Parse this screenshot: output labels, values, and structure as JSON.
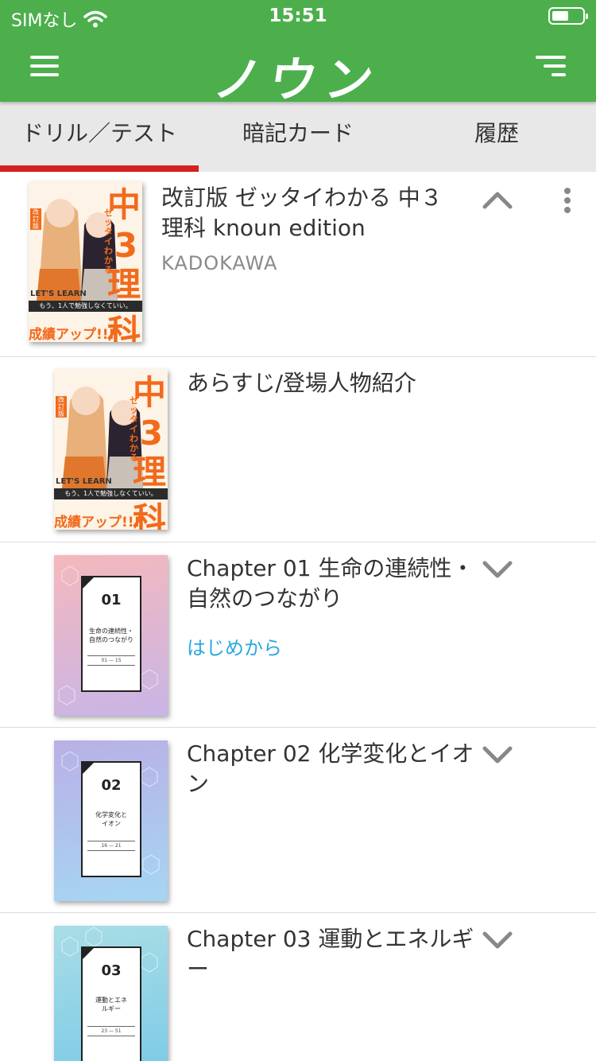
{
  "status_bar": {
    "carrier": "SIMなし",
    "time": "15:51"
  },
  "header": {
    "app_title": "ノウン"
  },
  "tabs": [
    {
      "label": "ドリル／テスト",
      "active": true
    },
    {
      "label": "暗記カード",
      "active": false
    },
    {
      "label": "履歴",
      "active": false
    }
  ],
  "book": {
    "title": "改訂版 ゼッタイわかる 中３理科 knoun edition",
    "publisher": "KADOKAWA",
    "cover": {
      "big_chars": [
        "中",
        "3",
        "理",
        "科"
      ],
      "vertical_title": "ゼッタイわかる",
      "badge": "改訂版",
      "banner": "もう、1人で勉強しなくていい。",
      "english": "LET'S LEARN",
      "footer": "成績アップ!!!"
    }
  },
  "items": [
    {
      "title": "あらすじ/登場人物紹介",
      "action": "はじめから"
    },
    {
      "title": "Chapter 01 生命の連続性・自然のつながり",
      "cover_number": "01",
      "cover_text": "生命の連続性・自然のつながり",
      "cover_pages": "01 — 15"
    },
    {
      "title": "Chapter 02 化学変化とイオン",
      "cover_number": "02",
      "cover_text": "化学変化とイオン",
      "cover_pages": "16 — 21"
    },
    {
      "title": "Chapter 03 運動とエネルギー",
      "cover_number": "03",
      "cover_text": "運動とエネルギー",
      "cover_pages": "23 — 51"
    }
  ],
  "icons": {
    "menu": "hamburger-icon",
    "sort": "sort-icon",
    "wifi": "wifi-icon",
    "battery": "battery-icon",
    "collapse": "chevron-up-icon",
    "expand": "chevron-down-icon",
    "more": "more-vertical-icon"
  },
  "colors": {
    "header_green": "#4caf4c",
    "tab_indicator": "#d42020",
    "tab_background": "#e8e8e8",
    "link_blue": "#29a8e0",
    "cover_orange": "#f26a1b",
    "chapter1_gradient": [
      "#f4b8bd",
      "#c9b5e6"
    ],
    "chapter2_gradient": [
      "#b9b0e6",
      "#a6d6f2"
    ],
    "chapter3_gradient": [
      "#a9dde6",
      "#78c9e6"
    ]
  }
}
